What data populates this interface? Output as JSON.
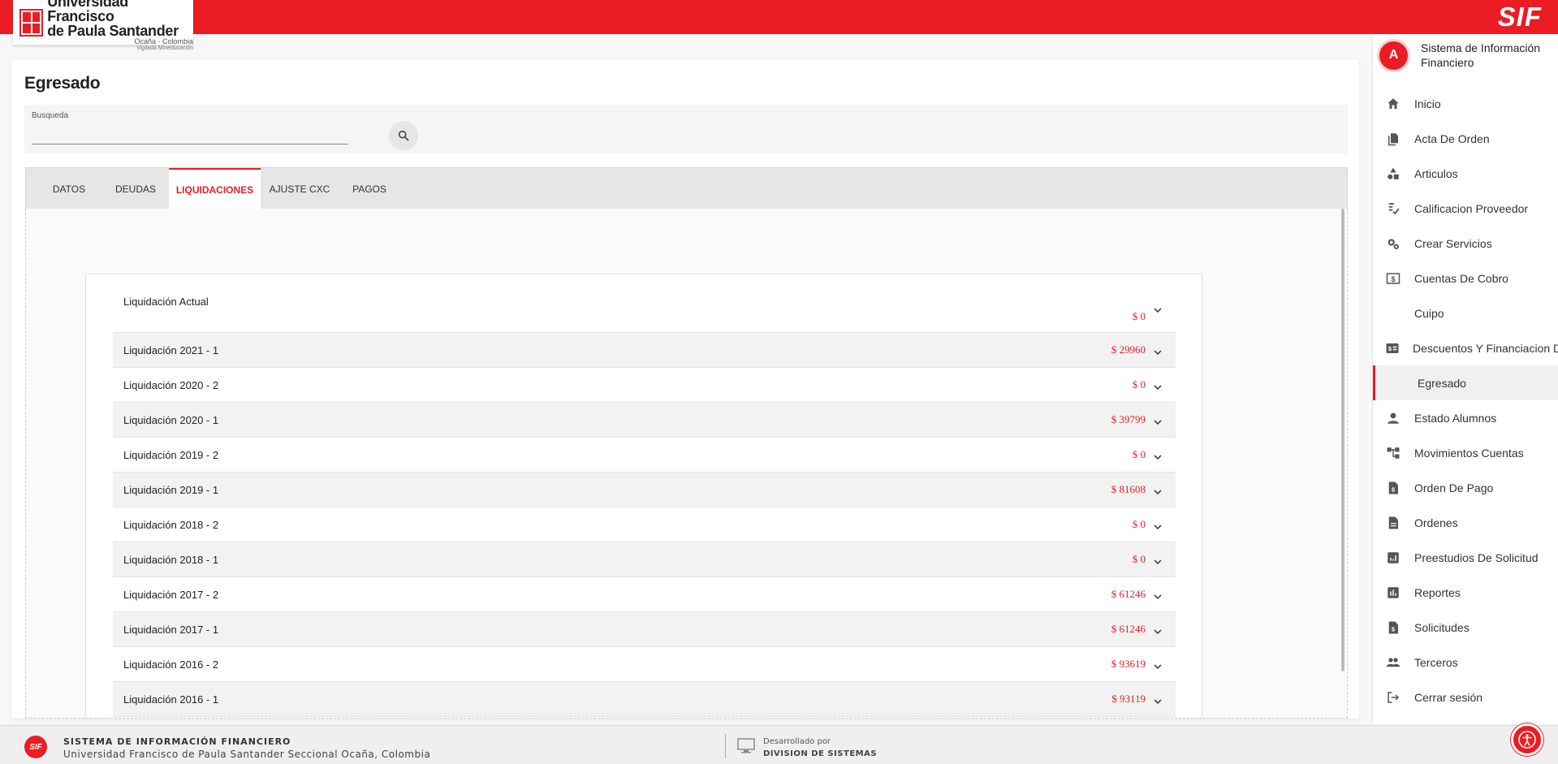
{
  "brand": {
    "logo_line1": "Universidad Francisco",
    "logo_line2": "de Paula Santander",
    "logo_line3": "Ocaña - Colombia",
    "logo_line4": "Vigilada Mineducación",
    "app_short": "SIF"
  },
  "page": {
    "title": "Egresado",
    "search_label": "Busqueda",
    "search_value": "",
    "search_icon": "search-icon"
  },
  "tabs": [
    {
      "label": "DATOS",
      "active": false
    },
    {
      "label": "DEUDAS",
      "active": false
    },
    {
      "label": "LIQUIDACIONES",
      "active": true
    },
    {
      "label": "AJUSTE CXC",
      "active": false
    },
    {
      "label": "PAGOS",
      "active": false
    }
  ],
  "liquidaciones": [
    {
      "name": "Liquidación Actual",
      "amount": "$ 0"
    },
    {
      "name": "Liquidación 2021 - 1",
      "amount": "$ 29960"
    },
    {
      "name": "Liquidación 2020 - 2",
      "amount": "$ 0"
    },
    {
      "name": "Liquidación 2020 - 1",
      "amount": "$ 39799"
    },
    {
      "name": "Liquidación 2019 - 2",
      "amount": "$ 0"
    },
    {
      "name": "Liquidación 2019 - 1",
      "amount": "$ 81608"
    },
    {
      "name": "Liquidación 2018 - 2",
      "amount": "$ 0"
    },
    {
      "name": "Liquidación 2018 - 1",
      "amount": "$ 0"
    },
    {
      "name": "Liquidación 2017 - 2",
      "amount": "$ 61246"
    },
    {
      "name": "Liquidación 2017 - 1",
      "amount": "$ 61246"
    },
    {
      "name": "Liquidación 2016 - 2",
      "amount": "$ 93619"
    },
    {
      "name": "Liquidación 2016 - 1",
      "amount": "$ 93119"
    }
  ],
  "sidebar": {
    "avatar_letter": "A",
    "title": "Sistema de Información Financiero",
    "items": [
      {
        "label": "Inicio",
        "icon": "home-icon"
      },
      {
        "label": "Acta De Orden",
        "icon": "documents-icon"
      },
      {
        "label": "Articulos",
        "icon": "shapes-icon"
      },
      {
        "label": "Calificacion Proveedor",
        "icon": "rating-icon"
      },
      {
        "label": "Crear Servicios",
        "icon": "gears-icon"
      },
      {
        "label": "Cuentas De Cobro",
        "icon": "money-icon"
      },
      {
        "label": "Cuipo",
        "icon": ""
      },
      {
        "label": "Descuentos Y Financiacion De",
        "icon": "discount-icon"
      },
      {
        "label": "Egresado",
        "icon": "",
        "active": true
      },
      {
        "label": "Estado Alumnos",
        "icon": "person-icon"
      },
      {
        "label": "Movimientos Cuentas",
        "icon": "tree-icon"
      },
      {
        "label": "Orden De Pago",
        "icon": "payment-doc-icon"
      },
      {
        "label": "Ordenes",
        "icon": "document-icon"
      },
      {
        "label": "Preestudios De Solicitud",
        "icon": "analytics-icon"
      },
      {
        "label": "Reportes",
        "icon": "bar-chart-icon"
      },
      {
        "label": "Solicitudes",
        "icon": "request-doc-icon"
      },
      {
        "label": "Terceros",
        "icon": "group-icon"
      },
      {
        "label": "Cerrar sesión",
        "icon": "logout-icon"
      }
    ]
  },
  "footer": {
    "logo": "SIF",
    "title": "SISTEMA DE INFORMACIÓN FINANCIERO",
    "subtitle": "Universidad Francisco de Paula Santander Seccional Ocaña, Colombia",
    "dev_label": "Desarrollado por",
    "dev_name": "DIVISION DE SISTEMAS"
  },
  "colors": {
    "brand_red": "#ec1c24",
    "amount_red": "#ec1c24"
  }
}
